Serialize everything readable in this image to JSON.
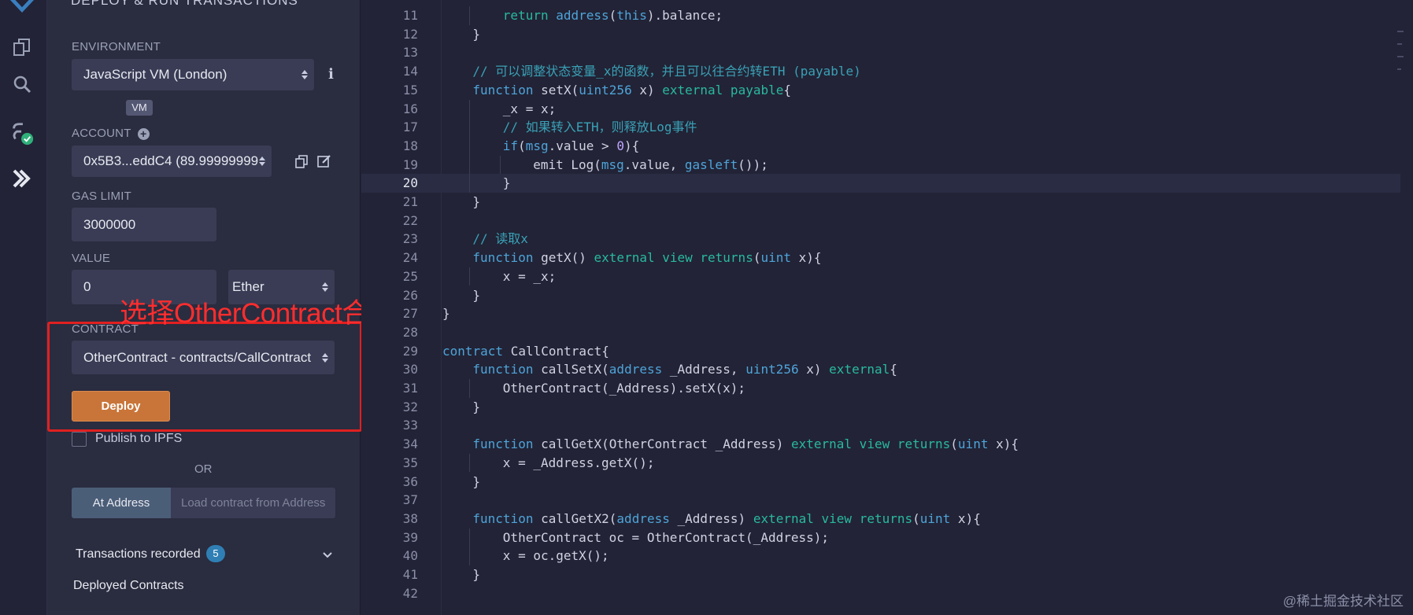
{
  "panel": {
    "title": "DEPLOY & RUN TRANSACTIONS",
    "environment_label": "ENVIRONMENT",
    "environment_value": "JavaScript VM (London)",
    "vm_badge": "VM",
    "account_label": "ACCOUNT",
    "account_value": "0x5B3...eddC4 (89.99999999",
    "gas_limit_label": "GAS LIMIT",
    "gas_limit_value": "3000000",
    "value_label": "VALUE",
    "value_value": "0",
    "value_unit": "Ether",
    "contract_label": "CONTRACT",
    "contract_value": "OtherContract - contracts/CallContract",
    "deploy_label": "Deploy",
    "publish_label": "Publish to IPFS",
    "or_label": "OR",
    "at_address_label": "At Address",
    "at_address_placeholder": "Load contract from Address",
    "transactions_recorded_label": "Transactions recorded",
    "transactions_recorded_count": "5",
    "deployed_contracts_label": "Deployed Contracts"
  },
  "annotation": {
    "text": "选择OtherContract合约部署",
    "color": "#ff2d2d"
  },
  "editor": {
    "active_line": "20",
    "lines": [
      {
        "n": "11",
        "indent": 2,
        "tokens": [
          [
            "kw2",
            "return "
          ],
          [
            "kw",
            "address"
          ],
          [
            "",
            "("
          ],
          [
            "kw",
            "this"
          ],
          [
            "",
            ")"
          ],
          [
            "",
            ".balance;"
          ]
        ]
      },
      {
        "n": "12",
        "indent": 1,
        "tokens": [
          [
            "",
            "}"
          ]
        ]
      },
      {
        "n": "13",
        "indent": 0,
        "tokens": []
      },
      {
        "n": "14",
        "indent": 1,
        "tokens": [
          [
            "cm",
            "// 可以调整状态变量_x的函数，并且可以往合约转ETH (payable)"
          ]
        ]
      },
      {
        "n": "15",
        "indent": 1,
        "tokens": [
          [
            "kw",
            "function "
          ],
          [
            "",
            "setX("
          ],
          [
            "kw",
            "uint256"
          ],
          [
            "",
            " x) "
          ],
          [
            "kw2",
            "external payable"
          ],
          [
            "",
            "{"
          ]
        ]
      },
      {
        "n": "16",
        "indent": 2,
        "tokens": [
          [
            "",
            "_x = x;"
          ]
        ]
      },
      {
        "n": "17",
        "indent": 2,
        "tokens": [
          [
            "cm",
            "// 如果转入ETH，则释放Log事件"
          ]
        ]
      },
      {
        "n": "18",
        "indent": 2,
        "tokens": [
          [
            "kw",
            "if"
          ],
          [
            "",
            "("
          ],
          [
            "kw",
            "msg"
          ],
          [
            "",
            ".value > "
          ],
          [
            "num",
            "0"
          ],
          [
            "",
            "){"
          ]
        ]
      },
      {
        "n": "19",
        "indent": 3,
        "tokens": [
          [
            "",
            "emit Log("
          ],
          [
            "kw",
            "msg"
          ],
          [
            "",
            ".value, "
          ],
          [
            "kw",
            "gasleft"
          ],
          [
            "",
            "());"
          ]
        ]
      },
      {
        "n": "20",
        "indent": 2,
        "tokens": [
          [
            "",
            "}"
          ]
        ]
      },
      {
        "n": "21",
        "indent": 1,
        "tokens": [
          [
            "",
            "}"
          ]
        ]
      },
      {
        "n": "22",
        "indent": 0,
        "tokens": []
      },
      {
        "n": "23",
        "indent": 1,
        "tokens": [
          [
            "cm",
            "// 读取x"
          ]
        ]
      },
      {
        "n": "24",
        "indent": 1,
        "tokens": [
          [
            "kw",
            "function "
          ],
          [
            "",
            "getX() "
          ],
          [
            "kw2",
            "external view returns"
          ],
          [
            "",
            "("
          ],
          [
            "kw",
            "uint"
          ],
          [
            "",
            " x){"
          ]
        ]
      },
      {
        "n": "25",
        "indent": 2,
        "tokens": [
          [
            "",
            "x = _x;"
          ]
        ]
      },
      {
        "n": "26",
        "indent": 1,
        "tokens": [
          [
            "",
            "}"
          ]
        ]
      },
      {
        "n": "27",
        "indent": 0,
        "tokens": [
          [
            "",
            "}"
          ]
        ]
      },
      {
        "n": "28",
        "indent": 0,
        "tokens": []
      },
      {
        "n": "29",
        "indent": 0,
        "tokens": [
          [
            "kw",
            "contract "
          ],
          [
            "",
            "CallContract{"
          ]
        ]
      },
      {
        "n": "30",
        "indent": 1,
        "tokens": [
          [
            "kw",
            "function "
          ],
          [
            "",
            "callSetX("
          ],
          [
            "kw",
            "address"
          ],
          [
            "",
            " _Address, "
          ],
          [
            "kw",
            "uint256"
          ],
          [
            "",
            " x) "
          ],
          [
            "kw2",
            "external"
          ],
          [
            "",
            "{"
          ]
        ]
      },
      {
        "n": "31",
        "indent": 2,
        "tokens": [
          [
            "",
            "OtherContract(_Address).setX(x);"
          ]
        ]
      },
      {
        "n": "32",
        "indent": 1,
        "tokens": [
          [
            "",
            "}"
          ]
        ]
      },
      {
        "n": "33",
        "indent": 0,
        "tokens": []
      },
      {
        "n": "34",
        "indent": 1,
        "tokens": [
          [
            "kw",
            "function "
          ],
          [
            "",
            "callGetX(OtherContract _Address) "
          ],
          [
            "kw2",
            "external view returns"
          ],
          [
            "",
            "("
          ],
          [
            "kw",
            "uint"
          ],
          [
            "",
            " x){"
          ]
        ]
      },
      {
        "n": "35",
        "indent": 2,
        "tokens": [
          [
            "",
            "x = _Address.getX();"
          ]
        ]
      },
      {
        "n": "36",
        "indent": 1,
        "tokens": [
          [
            "",
            "}"
          ]
        ]
      },
      {
        "n": "37",
        "indent": 0,
        "tokens": []
      },
      {
        "n": "38",
        "indent": 1,
        "tokens": [
          [
            "kw",
            "function "
          ],
          [
            "",
            "callGetX2("
          ],
          [
            "kw",
            "address"
          ],
          [
            "",
            " _Address) "
          ],
          [
            "kw2",
            "external view returns"
          ],
          [
            "",
            "("
          ],
          [
            "kw",
            "uint"
          ],
          [
            "",
            " x){"
          ]
        ]
      },
      {
        "n": "39",
        "indent": 2,
        "tokens": [
          [
            "",
            "OtherContract oc = OtherContract(_Address);"
          ]
        ]
      },
      {
        "n": "40",
        "indent": 2,
        "tokens": [
          [
            "",
            "x = oc.getX();"
          ]
        ]
      },
      {
        "n": "41",
        "indent": 1,
        "tokens": [
          [
            "",
            "}"
          ]
        ]
      },
      {
        "n": "42",
        "indent": 0,
        "tokens": []
      }
    ]
  },
  "watermark": "@稀土掘金技术社区",
  "colors": {
    "accent_deploy": "#c97539",
    "annotation_red": "#e02020",
    "keyword_blue": "#4ea4d9",
    "keyword_teal": "#29b9a0",
    "comment": "#3aa0b5"
  },
  "icons": [
    "remix-logo-icon",
    "file-explorer-icon",
    "search-icon",
    "compiler-check-icon",
    "deploy-run-icon",
    "copy-icon",
    "edit-icon",
    "info-icon",
    "add-account-icon",
    "chevron-down-icon"
  ]
}
